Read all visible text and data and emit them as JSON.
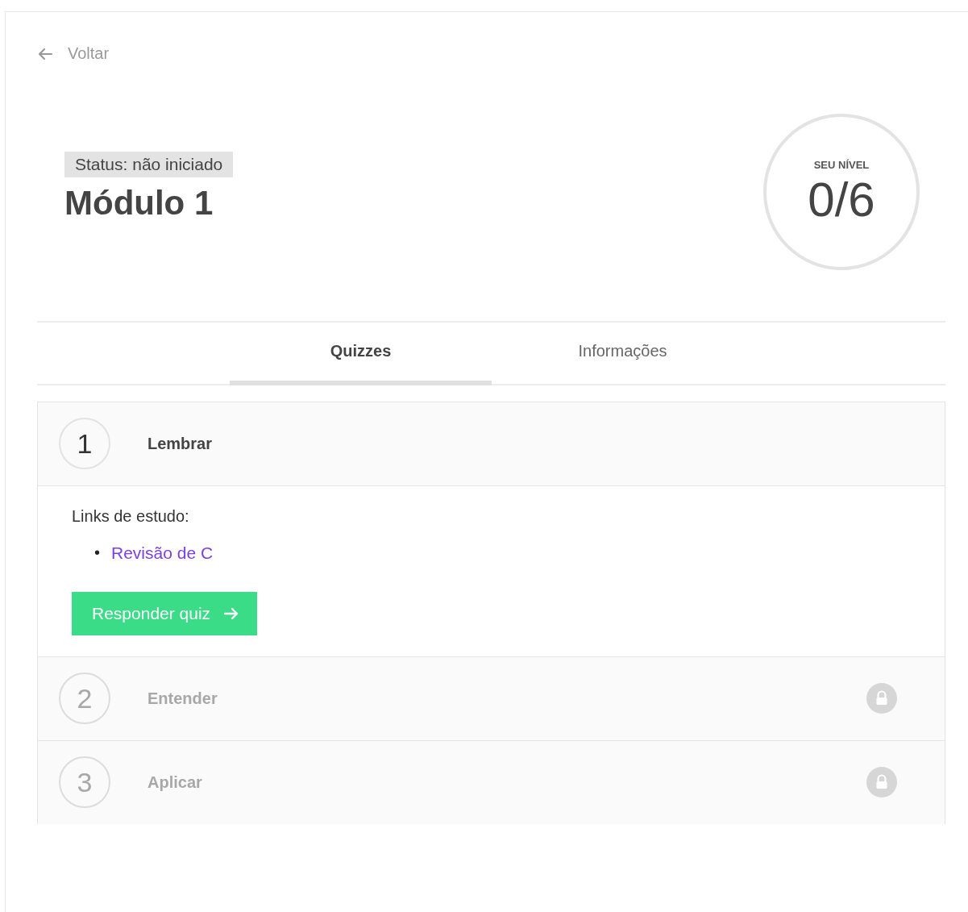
{
  "back_link": {
    "label": "Voltar"
  },
  "module": {
    "status": "Status: não iniciado",
    "title": "Módulo 1"
  },
  "level": {
    "label": "SEU NÍVEL",
    "value": "0/6"
  },
  "tabs": [
    {
      "label": "Quizzes",
      "selected": true
    },
    {
      "label": "Informações",
      "selected": false
    }
  ],
  "quizzes": [
    {
      "number": "1",
      "title": "Lembrar",
      "locked": false,
      "expanded": true,
      "links_heading": "Links de estudo:",
      "links": [
        {
          "bullet": "•",
          "label": "Revisão de C"
        }
      ],
      "button": "Responder quiz"
    },
    {
      "number": "2",
      "title": "Entender",
      "locked": true,
      "expanded": false
    },
    {
      "number": "3",
      "title": "Aplicar",
      "locked": true,
      "expanded": false
    }
  ]
}
